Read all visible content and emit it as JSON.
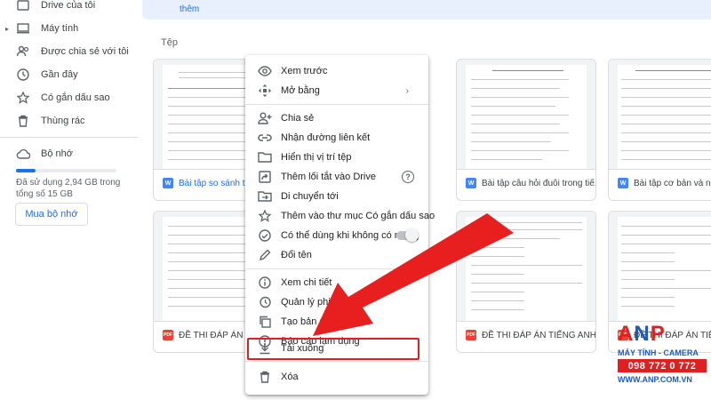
{
  "sidebar": {
    "items": [
      {
        "label": "Drive của tôi",
        "icon": "my-drive-icon"
      },
      {
        "label": "Máy tính",
        "icon": "computer-icon"
      },
      {
        "label": "Được chia sẻ với tôi",
        "icon": "shared-people-icon"
      },
      {
        "label": "Gần đây",
        "icon": "clock-icon"
      },
      {
        "label": "Có gắn dấu sao",
        "icon": "star-icon"
      },
      {
        "label": "Thùng rác",
        "icon": "trash-icon"
      }
    ],
    "storage": {
      "label": "Bộ nhớ",
      "used_text": "Đã sử dụng 2,94 GB trong tổng số 15 GB",
      "used_fraction": 0.196,
      "buy_label": "Mua bộ nhớ"
    }
  },
  "banner": {
    "text": "thêm"
  },
  "files_section": {
    "title": "Tệp"
  },
  "files": [
    {
      "name": "Bài tập so sánh tr",
      "type": "doc"
    },
    {
      "name": "Bài tập câu hỏi đuôi trong tiế...",
      "type": "doc"
    },
    {
      "name": "Bài tập cơ bản và nân",
      "type": "doc"
    },
    {
      "name": "ĐỀ THI ĐÁP ÁN TI",
      "type": "pdf"
    },
    {
      "name": "ĐỀ THI ĐÁP ÁN TIẾNG ANH ...",
      "type": "pdf"
    },
    {
      "name": "ĐỀ THI ĐÁP ÁN TIẾ",
      "type": "pdf"
    }
  ],
  "context_menu": {
    "items": [
      {
        "label": "Xem trước",
        "icon": "eye-icon"
      },
      {
        "label": "Mở bằng",
        "icon": "open-with-icon",
        "submenu": "›"
      },
      {
        "label": "Chia sẻ",
        "icon": "person-add-icon"
      },
      {
        "label": "Nhận đường liên kết",
        "icon": "link-icon"
      },
      {
        "label": "Hiển thị vị trí tệp",
        "icon": "folder-icon"
      },
      {
        "label": "Thêm lối tắt vào Drive",
        "icon": "shortcut-icon",
        "help": "?"
      },
      {
        "label": "Di chuyển tới",
        "icon": "move-folder-icon"
      },
      {
        "label": "Thêm vào thư mục Có gắn dấu sao",
        "icon": "star-outline-icon"
      },
      {
        "label": "Có thể dùng khi không có mạng",
        "icon": "offline-icon",
        "toggle": false
      },
      {
        "label": "Đổi tên",
        "icon": "pencil-icon"
      },
      {
        "label": "Xem chi tiết",
        "icon": "info-icon"
      },
      {
        "label": "Quản lý phiên bản",
        "icon": "history-icon"
      },
      {
        "label": "Tạo bản sao",
        "icon": "copy-icon"
      },
      {
        "label": "Báo cáo lạm dụng",
        "icon": "report-icon"
      },
      {
        "label": "Tải xuống",
        "icon": "download-icon"
      },
      {
        "label": "Xóa",
        "icon": "delete-icon"
      }
    ],
    "highlighted": "Tải xuống"
  },
  "watermark": {
    "logo_left": "A",
    "logo_mid": "N",
    "logo_right": "P",
    "line1": "MÁY TÍNH - CAMERA",
    "line2": "098 772 0 772",
    "line3": "WWW.ANP.COM.VN"
  },
  "colors": {
    "accent": "#1a73e8",
    "arrow": "#e02020",
    "pdf": "#ea4335",
    "doc": "#4285f4"
  }
}
